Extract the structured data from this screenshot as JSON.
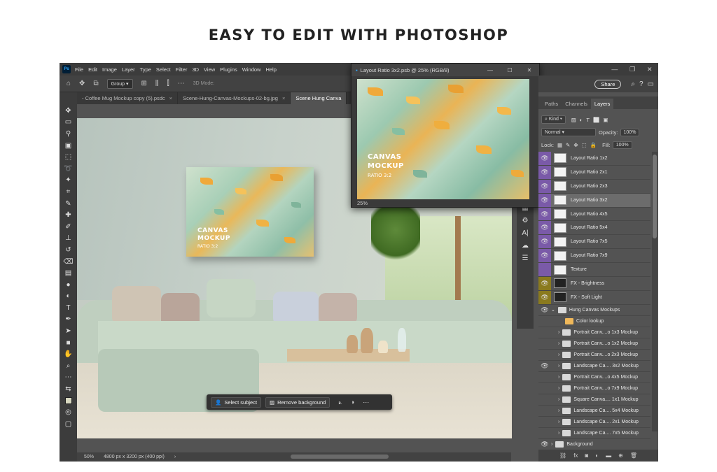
{
  "headline": "EASY TO EDIT WITH PHOTOSHOP",
  "menu": [
    "File",
    "Edit",
    "Image",
    "Layer",
    "Type",
    "Select",
    "Filter",
    "3D",
    "View",
    "Plugins",
    "Window",
    "Help"
  ],
  "options": {
    "group_label": "Group",
    "mode3d": "3D Mode:"
  },
  "tabs": [
    {
      "label": "- Coffee Mug Mockup copy (5).psdc",
      "active": false
    },
    {
      "label": "Scene-Hung-Canvas-Mockups-02-bg.jpg",
      "active": false
    },
    {
      "label": "Scene Hung Canva",
      "active": true
    }
  ],
  "painting": {
    "title": "CANVAS",
    "title2": "MOCKUP",
    "subtitle": "RATIO 3:2"
  },
  "context_bar": {
    "select_subject": "Select subject",
    "remove_background": "Remove background"
  },
  "status": {
    "zoom": "50%",
    "size": "4800 px x 3200 px (400 ppi)"
  },
  "preview_window": {
    "title": "Layout Ratio 3x2.psb @ 25% (RGB/8)",
    "zoom": "25%"
  },
  "right_top": {
    "share": "Share"
  },
  "panel_tabs": [
    "Paths",
    "Channels",
    "Layers"
  ],
  "layer_controls": {
    "kind": "Kind",
    "blend": "Normal",
    "opacity_label": "Opacity:",
    "opacity": "100%",
    "lock_label": "Lock:",
    "fill_label": "Fill:",
    "fill": "100%"
  },
  "layers": [
    {
      "name": "Layout Ratio 1x2",
      "visible": true,
      "selected": false
    },
    {
      "name": "Layout Ratio 2x1",
      "visible": true,
      "selected": false
    },
    {
      "name": "Layout Ratio 2x3",
      "visible": true,
      "selected": false
    },
    {
      "name": "Layout Ratio 3x2",
      "visible": true,
      "selected": true
    },
    {
      "name": "Layout Ratio 4x5",
      "visible": true,
      "selected": false
    },
    {
      "name": "Layout Ratio 5x4",
      "visible": true,
      "selected": false
    },
    {
      "name": "Layout Ratio 7x5",
      "visible": true,
      "selected": false
    },
    {
      "name": "Layout Ratio 7x9",
      "visible": true,
      "selected": false
    },
    {
      "name": "Texture",
      "visible": false,
      "selected": false
    },
    {
      "name": "FX - Brightness",
      "visible": true,
      "selected": false
    },
    {
      "name": "FX - Soft Light",
      "visible": true,
      "selected": false
    }
  ],
  "group_layers": [
    {
      "name": "Hung Canvas Mockups",
      "visible": true
    },
    {
      "name": "Color lookup",
      "visible": false
    },
    {
      "name": "Portrait Canv....o 1x3 Mockup",
      "visible": false
    },
    {
      "name": "Portrait Canv....o 1x2 Mockup",
      "visible": false
    },
    {
      "name": "Portrait Canv....o 2x3 Mockup",
      "visible": false
    },
    {
      "name": "Landscape Ca.... 3x2 Mockup",
      "visible": true
    },
    {
      "name": "Portrait Canv....o 4x5 Mockup",
      "visible": false
    },
    {
      "name": "Portrait Canv....o 7x9 Mockup",
      "visible": false
    },
    {
      "name": "Square Canva.... 1x1 Mockup",
      "visible": false
    },
    {
      "name": "Landscape Ca.... 5x4 Mockup",
      "visible": false
    },
    {
      "name": "Landscape Ca.... 2x1 Mockup",
      "visible": false
    },
    {
      "name": "Landscape Ca.... 7x5 Mockup",
      "visible": false
    },
    {
      "name": "Background",
      "visible": true
    }
  ],
  "colors": {
    "accent_purple": "#7a5aa8",
    "accent_olive": "#8a7a1e"
  }
}
